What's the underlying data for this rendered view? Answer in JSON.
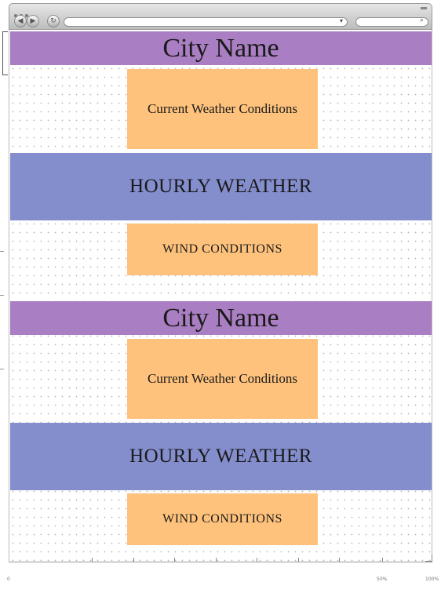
{
  "browser": {
    "back_glyph": "◀",
    "forward_glyph": "▶",
    "reload_glyph": "↻",
    "url_dropdown_glyph": "▾",
    "search_glyph": "⌕"
  },
  "sections": [
    {
      "city": "City Name",
      "current": "Current Weather Conditions",
      "hourly": "HOURLY WEATHER",
      "wind": "WIND CONDITIONS"
    },
    {
      "city": "City Name",
      "current": "Current Weather Conditions",
      "hourly": "HOURLY WEATHER",
      "wind": "WIND CONDITIONS"
    }
  ],
  "ruler": {
    "label_start": "0",
    "label_mid": "50%",
    "label_end": "100%"
  },
  "colors": {
    "city_band": "#a97ec2",
    "hourly_band": "#848ecd",
    "content_box": "#fec27c"
  }
}
